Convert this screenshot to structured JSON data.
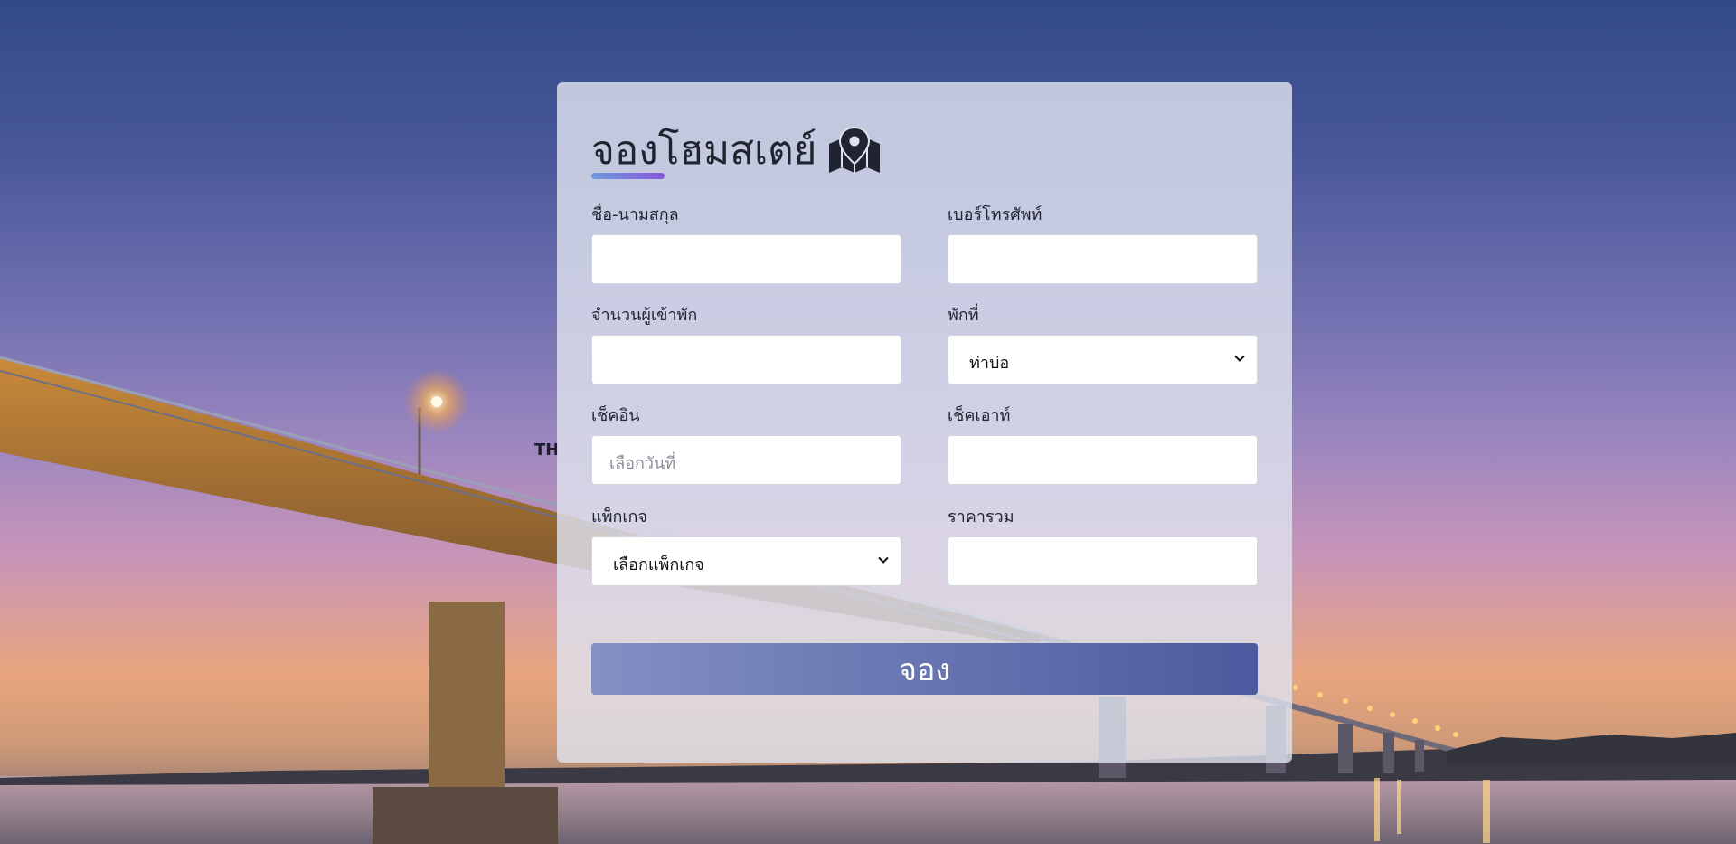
{
  "background": {
    "overlay_text": "TH"
  },
  "form": {
    "title": "จองโฮมสเตย์",
    "title_icon": "map-marker-icon",
    "accent_gradient": [
      "#6f9be0",
      "#8a58d8"
    ],
    "fields": {
      "full_name": {
        "label": "ชื่อ-นามสกุล",
        "value": ""
      },
      "phone": {
        "label": "เบอร์โทรศัพท์",
        "value": ""
      },
      "guests": {
        "label": "จำนวนผู้เข้าพัก",
        "value": ""
      },
      "stay_at": {
        "label": "พักที่",
        "selected": "ท่าบ่อ"
      },
      "check_in": {
        "label": "เช็คอิน",
        "placeholder": "เลือกวันที่"
      },
      "check_out": {
        "label": "เช็คเอาท์",
        "value": ""
      },
      "package": {
        "label": "แพ็กเกจ",
        "selected": "เลือกแพ็กเกจ"
      },
      "total_price": {
        "label": "ราคารวม",
        "value": ""
      }
    },
    "submit_label": "จอง",
    "submit_gradient": [
      "#8390c4",
      "#4b5a9e"
    ]
  }
}
